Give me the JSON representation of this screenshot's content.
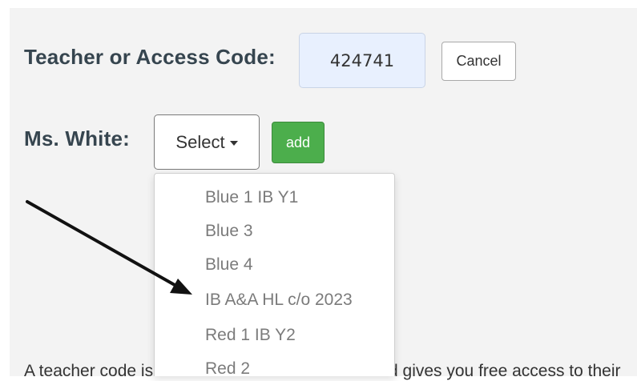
{
  "form": {
    "code_label": "Teacher or Access Code:",
    "code_value": "424741",
    "cancel_label": "Cancel",
    "teacher_label": "Ms. White:",
    "select_label": "Select",
    "add_label": "add"
  },
  "dropdown": {
    "items": [
      "Blue 1 IB Y1",
      "Blue 3",
      "Blue 4",
      "IB A&A HL c/o 2023",
      "Red 1 IB Y2",
      "Red 2"
    ]
  },
  "info": {
    "left_text": "A teacher code is",
    "right_text": "d gives you free access to their"
  },
  "colors": {
    "input_bg": "#e8f0fe",
    "add_button_bg": "#4cae4c",
    "label_color": "#36454f",
    "item_color": "#7b7b7b"
  },
  "annotation": {
    "icon": "arrow-icon",
    "points_to": "IB A&A HL c/o 2023"
  }
}
